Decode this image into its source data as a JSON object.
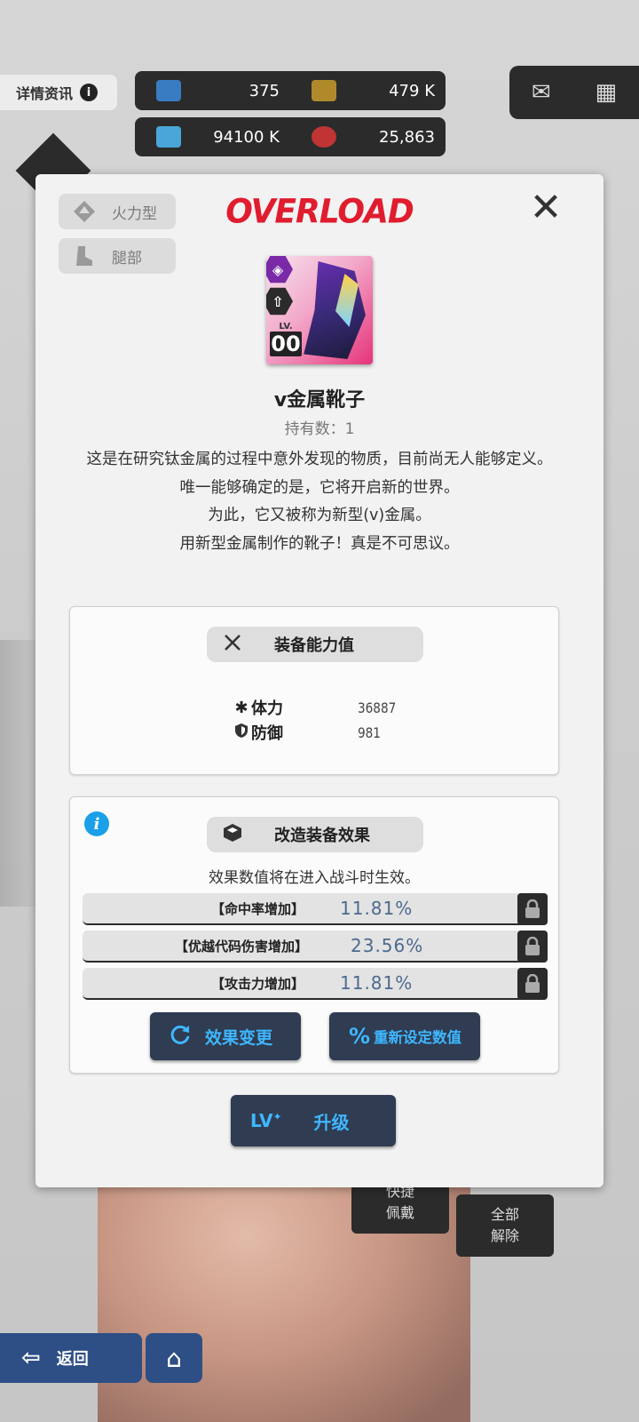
{
  "hud": {
    "details_label": "详情资讯",
    "resources": [
      "375",
      "479 K",
      "94100 K",
      "25,863"
    ],
    "bottom": {
      "back_label": "返回"
    },
    "quick_equip_label": "快捷\n佩戴",
    "unequip_all_label": "全部\n解除"
  },
  "modal": {
    "tags": {
      "class": "火力型",
      "slot": "腿部"
    },
    "brand": "OVERLOAD",
    "item": {
      "level": "00",
      "level_prefix": "LV.",
      "name": "v金属靴子",
      "owned": "持有数：1",
      "description": [
        "这是在研究钛金属的过程中意外发现的物质，目前尚无人能够定义。",
        "唯一能够确定的是，它将开启新的世界。",
        "为此，它又被称为新型(v)金属。",
        "用新型金属制作的靴子！真是不可思议。"
      ]
    },
    "stats_panel": {
      "title": "装备能力值",
      "stats": [
        {
          "label": "体力",
          "value": "36887"
        },
        {
          "label": "防御",
          "value": "981"
        }
      ]
    },
    "effects_panel": {
      "title": "改造装备效果",
      "note": "效果数值将在进入战斗时生效。",
      "effects": [
        {
          "label": "【命中率增加】",
          "value": "11.81%"
        },
        {
          "label": "【优越代码伤害增加】",
          "value": "23.56%"
        },
        {
          "label": "【攻击力增加】",
          "value": "11.81%"
        }
      ],
      "change_label": "效果变更",
      "reset_label": "重新设定数值"
    },
    "levelup": {
      "prefix": "LV",
      "label": "升级"
    }
  },
  "colors": {
    "accent": "#3fb7ff",
    "brand_red": "#e01c2f",
    "info_blue": "#1aa0e8",
    "button_bg": "#2f3c52"
  }
}
